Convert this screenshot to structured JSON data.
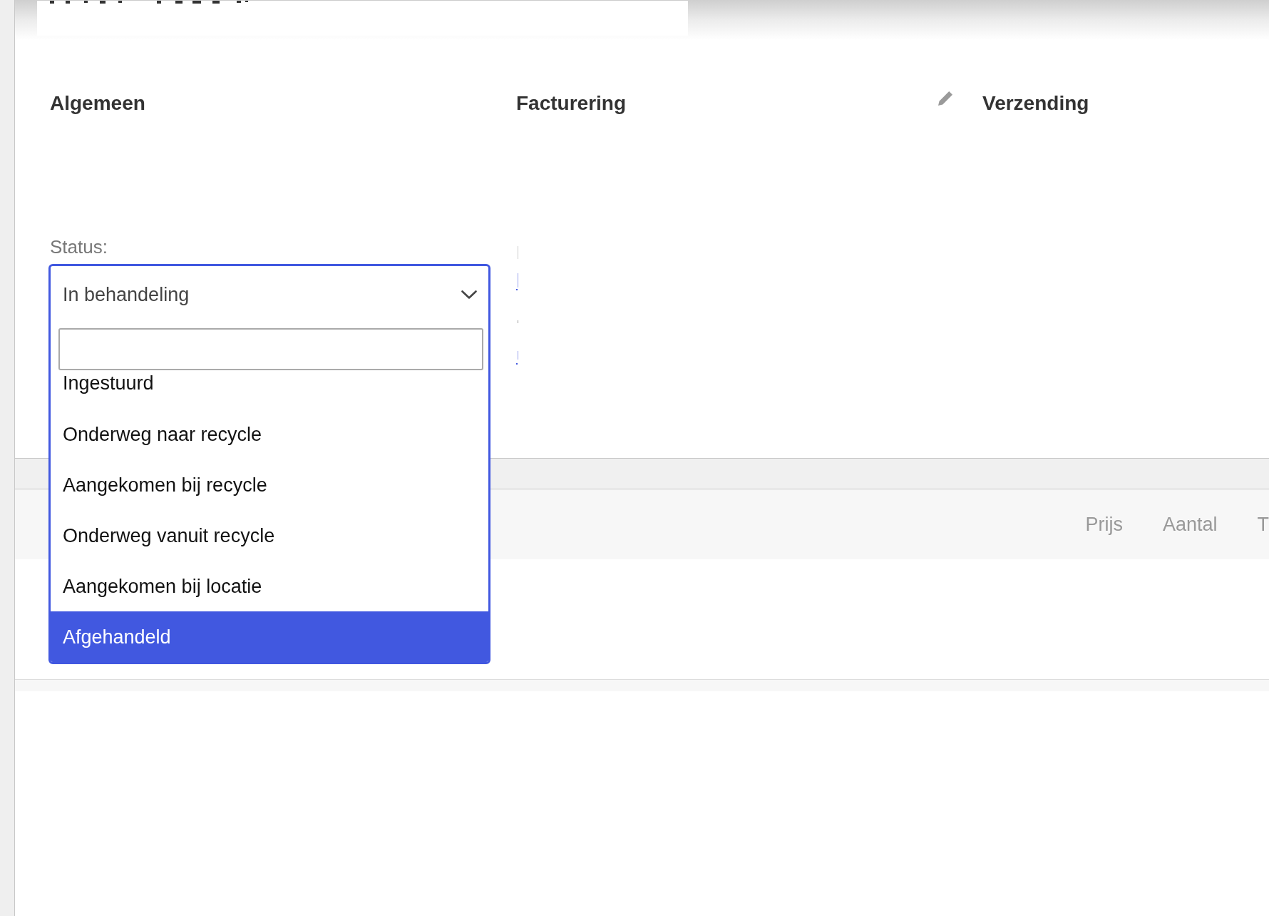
{
  "sections": [
    {
      "title": "Algemeen",
      "edit": false,
      "status_field": {
        "label": "Status:",
        "value": "In behandeling",
        "expanded": true,
        "options": [
          {
            "label": "Ingestuurd",
            "highlighted": false
          },
          {
            "label": "Onderweg naar recycle",
            "highlighted": false
          },
          {
            "label": "Aangekomen bij recycle",
            "highlighted": false
          },
          {
            "label": "Onderweg vanuit recycle",
            "highlighted": false
          },
          {
            "label": "Aangekomen bij locatie",
            "highlighted": false
          },
          {
            "label": "Afgehandeld",
            "highlighted": true
          }
        ]
      }
    },
    {
      "title": "Facturering",
      "edit": true
    },
    {
      "title": "Verzending",
      "edit": false
    }
  ],
  "items_table": {
    "columns": [
      "Prijs",
      "Aantal",
      "T"
    ]
  }
}
